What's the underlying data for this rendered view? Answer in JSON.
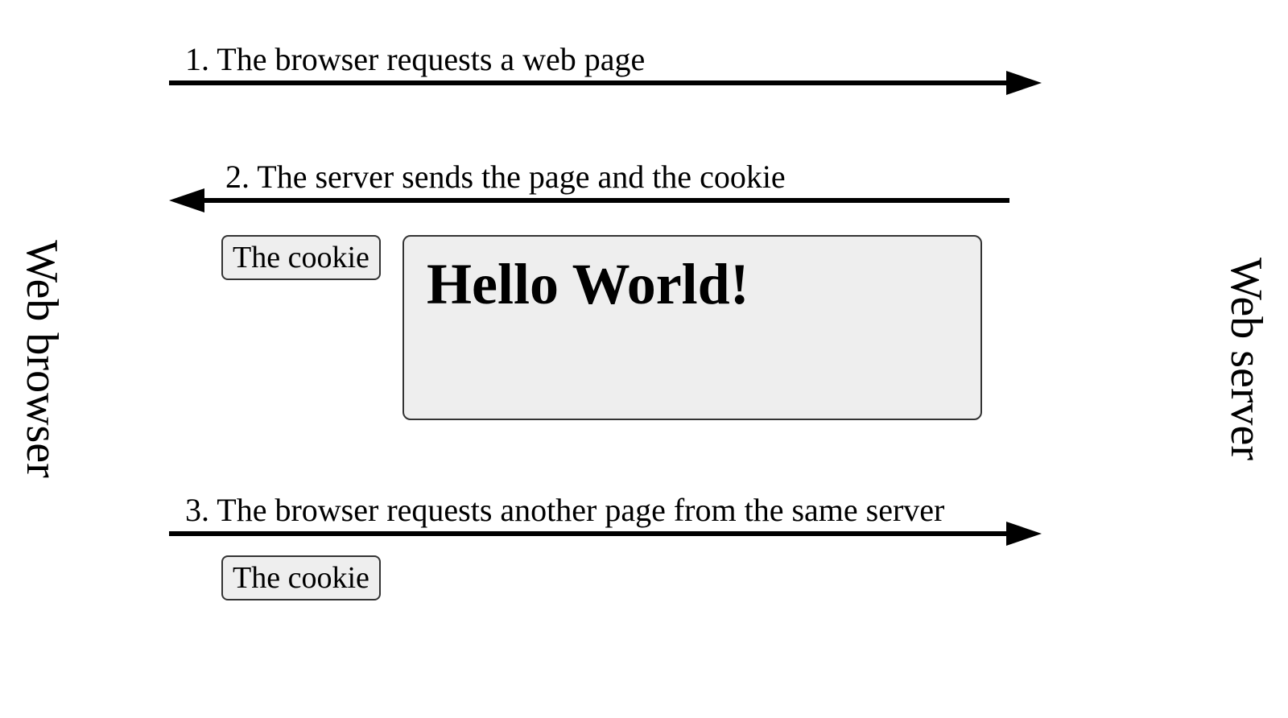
{
  "labels": {
    "web_browser": "Web browser",
    "web_server": "Web server"
  },
  "steps": {
    "s1": "1. The browser requests a web page",
    "s2": "2. The server sends the page and the cookie",
    "s3": "3. The browser requests another page from the same server"
  },
  "cookie_label": "The cookie",
  "page_content": "Hello World!"
}
